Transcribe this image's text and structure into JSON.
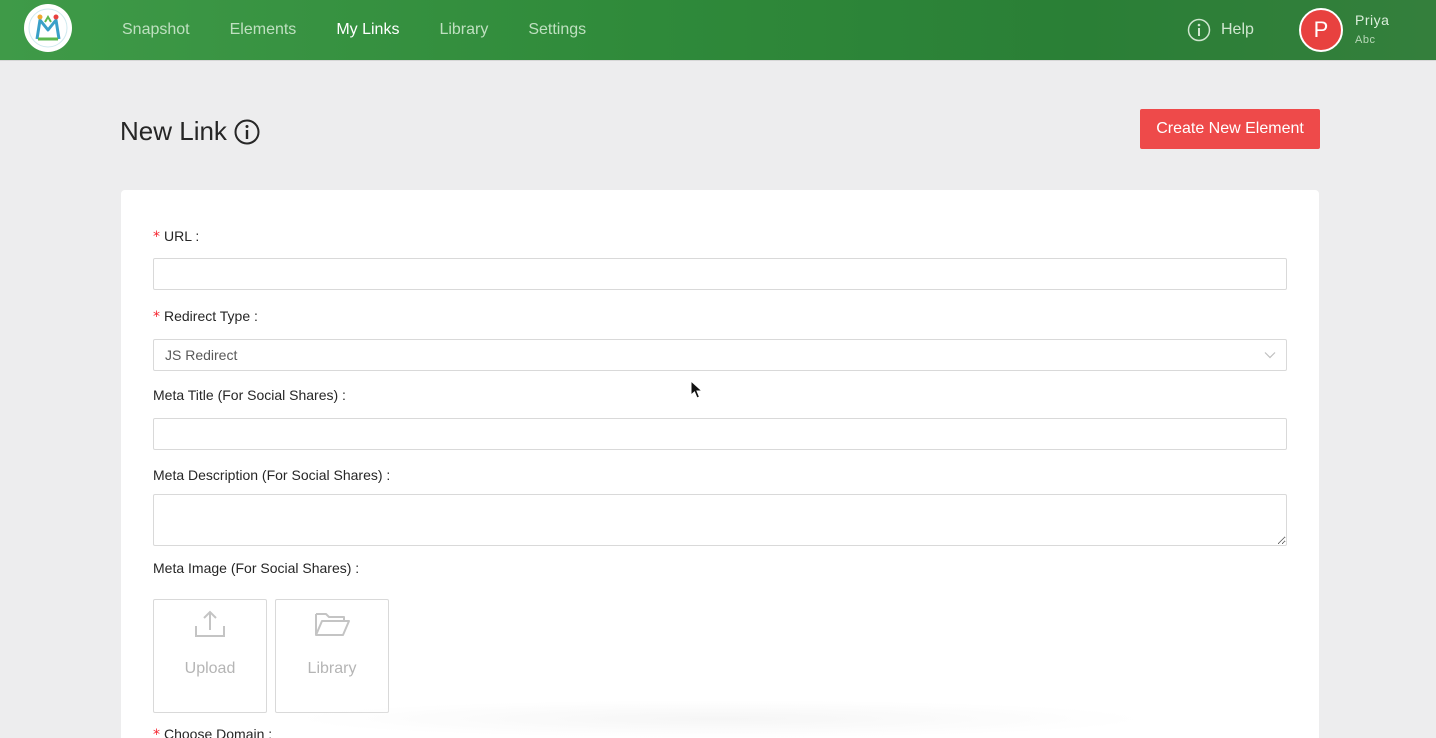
{
  "nav": {
    "items": [
      {
        "label": "Snapshot",
        "active": false
      },
      {
        "label": "Elements",
        "active": false
      },
      {
        "label": "My Links",
        "active": true
      },
      {
        "label": "Library",
        "active": false
      },
      {
        "label": "Settings",
        "active": false
      }
    ],
    "help_label": "Help"
  },
  "user": {
    "initial": "P",
    "name": "Priya",
    "org": "Abc",
    "avatar_color": "#e8413f"
  },
  "page": {
    "title": "New Link",
    "create_button": "Create New Element"
  },
  "form": {
    "url_label": "URL",
    "url_value": "",
    "redirect_label": "Redirect Type",
    "redirect_value": "JS Redirect",
    "meta_title_label": "Meta Title (For Social Shares)",
    "meta_title_value": "",
    "meta_desc_label": "Meta Description (For Social Shares)",
    "meta_desc_value": "",
    "meta_image_label": "Meta Image (For Social Shares)",
    "upload_label": "Upload",
    "library_label": "Library",
    "domain_label": "Choose Domain"
  },
  "colors": {
    "accent_green": "#2f8a3a",
    "create_button": "#ee4a4a",
    "required": "#f5222d"
  },
  "icons": [
    "app-logo-icon",
    "help-icon",
    "info-icon",
    "chevron-down-icon",
    "upload-icon",
    "folder-open-icon",
    "mouse-cursor-icon"
  ]
}
